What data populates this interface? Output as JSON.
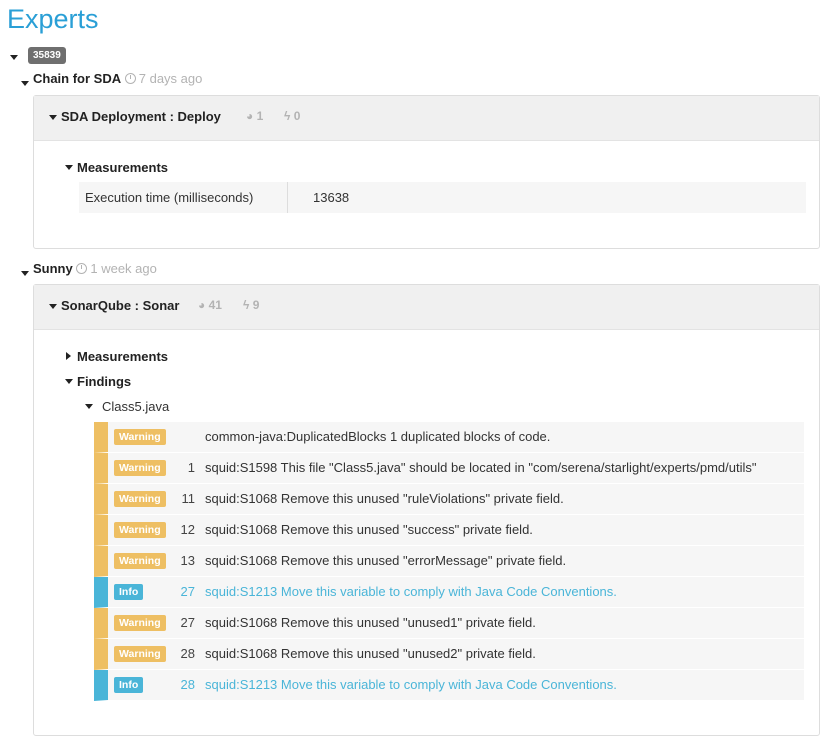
{
  "page_title": "Experts",
  "root_badge": "35839",
  "chain": {
    "name": "Chain for SDA",
    "age": "7 days ago",
    "panel": {
      "title": "SDA Deployment : Deploy",
      "gauge": "1",
      "bolt": "0",
      "measurements_label": "Measurements",
      "measurement": {
        "name": "Execution time (milliseconds)",
        "value": "13638"
      }
    }
  },
  "sunny": {
    "name": "Sunny",
    "age": "1 week ago",
    "panel": {
      "title": "SonarQube : Sonar",
      "gauge": "41",
      "bolt": "9",
      "measurements_label": "Measurements",
      "findings_label": "Findings",
      "file": "Class5.java",
      "findings": [
        {
          "level": "Warning",
          "line": "",
          "text": "common-java:DuplicatedBlocks 1 duplicated blocks of code."
        },
        {
          "level": "Warning",
          "line": "1",
          "text": "squid:S1598 This file \"Class5.java\" should be located in \"com/serena/starlight/experts/pmd/utils\""
        },
        {
          "level": "Warning",
          "line": "11",
          "text": "squid:S1068 Remove this unused \"ruleViolations\" private field."
        },
        {
          "level": "Warning",
          "line": "12",
          "text": "squid:S1068 Remove this unused \"success\" private field."
        },
        {
          "level": "Warning",
          "line": "13",
          "text": "squid:S1068 Remove this unused \"errorMessage\" private field."
        },
        {
          "level": "Info",
          "line": "27",
          "text": "squid:S1213 Move this variable to comply with Java Code Conventions."
        },
        {
          "level": "Warning",
          "line": "27",
          "text": "squid:S1068 Remove this unused \"unused1\" private field."
        },
        {
          "level": "Warning",
          "line": "28",
          "text": "squid:S1068 Remove this unused \"unused2\" private field."
        },
        {
          "level": "Info",
          "line": "28",
          "text": "squid:S1213 Move this variable to comply with Java Code Conventions."
        }
      ]
    }
  },
  "colors": {
    "title": "#2a9fd6",
    "warning": "#eebf63",
    "info": "#4ab5d8"
  }
}
